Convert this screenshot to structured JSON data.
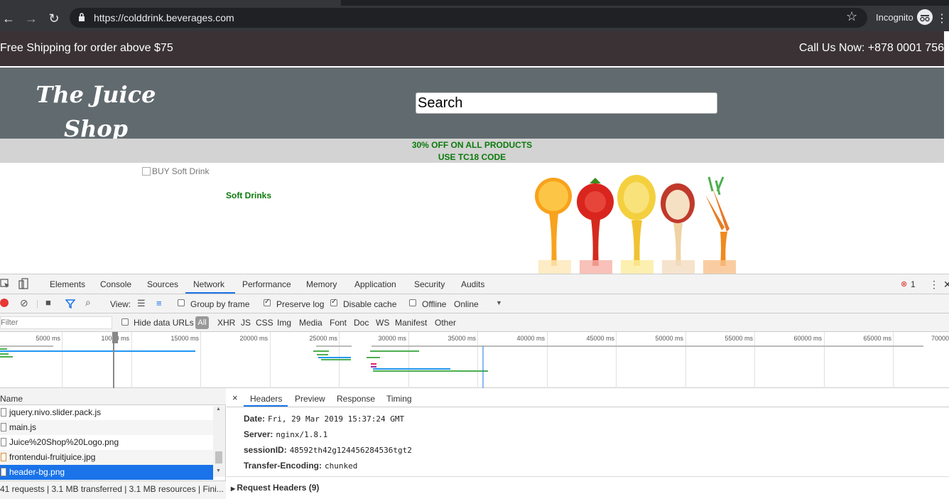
{
  "browser": {
    "url": "https://colddrink.beverages.com",
    "incognito_label": "Incognito"
  },
  "site": {
    "shipping_text": "Free Shipping for order above $75",
    "call_text": "Call Us Now: +878 0001 756",
    "logo_line1": "The Juice",
    "logo_line2": "Shop",
    "search_value": "Search",
    "promo_line1": "30% OFF ON ALL PRODUCTS",
    "promo_line2": "USE TC18 CODE",
    "buy_alt": "BUY Soft Drink",
    "soft_drinks": "Soft Drinks"
  },
  "devtools": {
    "tabs": [
      "Elements",
      "Console",
      "Sources",
      "Network",
      "Performance",
      "Memory",
      "Application",
      "Security",
      "Audits"
    ],
    "active_tab": "Network",
    "error_count": "1",
    "toolbar": {
      "view_label": "View:",
      "group_by_frame": "Group by frame",
      "preserve_log": "Preserve log",
      "disable_cache": "Disable cache",
      "offline": "Offline",
      "throttle": "Online"
    },
    "filter": {
      "placeholder": "Filter",
      "hide_data_urls": "Hide data URLs",
      "types": [
        "All",
        "XHR",
        "JS",
        "CSS",
        "Img",
        "Media",
        "Font",
        "Doc",
        "WS",
        "Manifest",
        "Other"
      ]
    },
    "timeline_labels": [
      "5000 ms",
      "10000 ms",
      "15000 ms",
      "20000 ms",
      "25000 ms",
      "30000 ms",
      "35000 ms",
      "40000 ms",
      "45000 ms",
      "50000 ms",
      "55000 ms",
      "60000 ms",
      "65000 ms",
      "70000"
    ],
    "name_header": "Name",
    "requests": [
      {
        "name": "jquery.nivo.slider.pack.js"
      },
      {
        "name": "main.js"
      },
      {
        "name": "Juice%20Shop%20Logo.png"
      },
      {
        "name": "frontendui-fruitjuice.jpg"
      },
      {
        "name": "header-bg.png"
      }
    ],
    "status": "41 requests | 3.1 MB transferred | 3.1 MB resources | Fini...",
    "detail_tabs": [
      "Headers",
      "Preview",
      "Response",
      "Timing"
    ],
    "response_headers": [
      {
        "key": "Date:",
        "value": "Fri, 29 Mar 2019 15:37:24 GMT"
      },
      {
        "key": "Server:",
        "value": "nginx/1.8.1"
      },
      {
        "key": "sessionID:",
        "value": "48592th42g124456284536tgt2"
      },
      {
        "key": "Transfer-Encoding:",
        "value": "chunked"
      }
    ],
    "request_headers_label": "Request Headers (9)"
  }
}
